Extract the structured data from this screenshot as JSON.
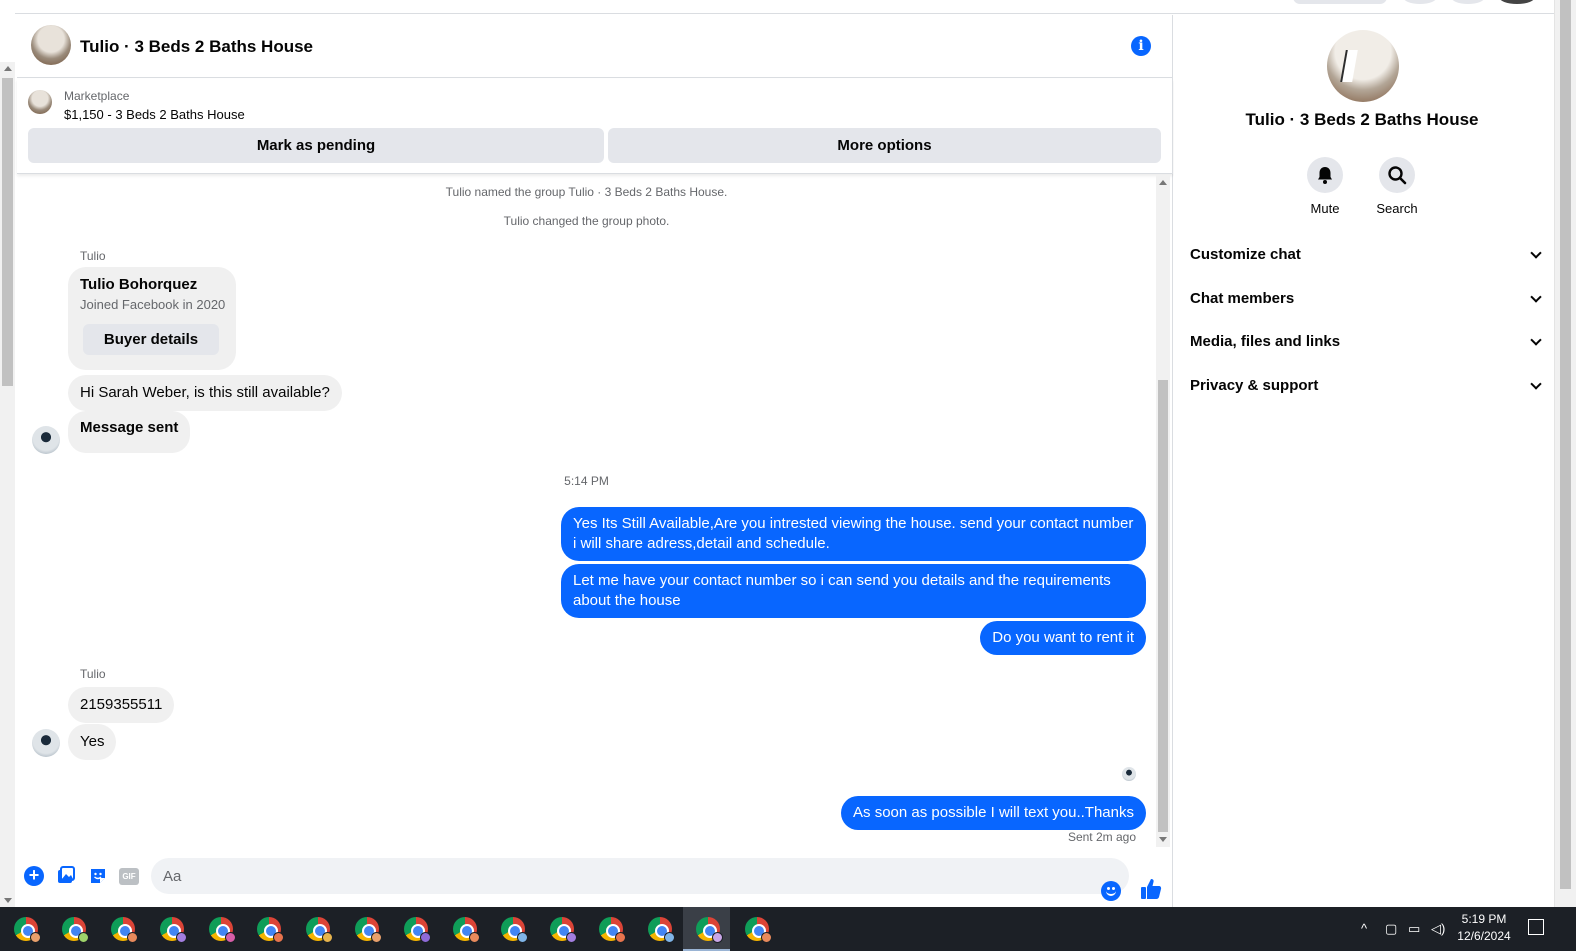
{
  "chat": {
    "title": "Tulio · 3 Beds 2 Baths House",
    "marketplace_label": "Marketplace",
    "listing": "$1,150 - 3 Beds 2 Baths House",
    "mark_pending_label": "Mark as pending",
    "more_options_label": "More options"
  },
  "messages": {
    "system_notes": [
      "Tulio named the group Tulio · 3 Beds 2 Baths House.",
      "Tulio changed the group photo."
    ],
    "sender_name": "Tulio",
    "card": {
      "name": "Tulio Bohorquez",
      "subtitle": "Joined Facebook in 2020",
      "button_label": "Buyer details"
    },
    "incoming_1": "Hi Sarah Weber, is this still available?",
    "incoming_2": "Message sent",
    "time_label": "5:14 PM",
    "outgoing_1": "Yes Its Still Available,Are you intrested viewing the house. send your contact number i will share adress,detail and schedule.",
    "outgoing_2": "Let me have your contact number so i can send you details and the requirements about the house",
    "outgoing_3": "Do you want to rent it",
    "incoming_3": "2159355511",
    "incoming_4": "Yes",
    "outgoing_4": "As soon as possible I will text you..Thanks",
    "sent_status": "Sent 2m ago"
  },
  "composer": {
    "placeholder": "Aa",
    "gif_label": "GIF"
  },
  "details": {
    "title": "Tulio · 3 Beds 2 Baths House",
    "mute_label": "Mute",
    "search_label": "Search",
    "sections": [
      "Customize chat",
      "Chat members",
      "Media, files and links",
      "Privacy & support"
    ]
  },
  "taskbar": {
    "time": "5:19 PM",
    "date": "12/6/2024",
    "chrome_icons": [
      "chrome-icon",
      "chrome-icon",
      "chrome-icon",
      "chrome-icon",
      "chrome-icon",
      "chrome-icon",
      "chrome-icon",
      "chrome-icon",
      "chrome-icon",
      "chrome-icon",
      "chrome-icon",
      "chrome-icon",
      "chrome-icon",
      "chrome-icon",
      "chrome-icon",
      "chrome-icon"
    ]
  },
  "colors": {
    "accent": "#0866ff",
    "bubble_in": "#f0f0f0",
    "taskbar": "#1c2026"
  }
}
